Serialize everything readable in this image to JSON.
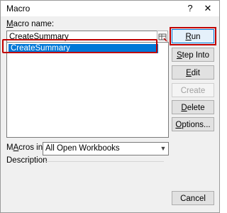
{
  "window": {
    "title": "Macro",
    "help_glyph": "?",
    "close_glyph": "✕"
  },
  "macro_name": {
    "label_mnemonic": "M",
    "label_rest": "acro name:",
    "value": "CreateSummary"
  },
  "macro_list": {
    "items": [
      "CreateSummary"
    ]
  },
  "buttons": {
    "run": {
      "mnemonic": "R",
      "rest": "un"
    },
    "step_into": {
      "mnemonic": "S",
      "rest": "tep Into"
    },
    "edit": {
      "mnemonic": "E",
      "rest": "dit"
    },
    "create": {
      "label": "Create"
    },
    "delete": {
      "mnemonic": "D",
      "rest": "elete"
    },
    "options": {
      "mnemonic": "O",
      "rest": "ptions..."
    },
    "cancel": {
      "label": "Cancel"
    }
  },
  "macros_in": {
    "label_mnemonic": "A",
    "label_prefix": "M",
    "label_rest": "cros in:",
    "value": "All Open Workbooks"
  },
  "description": {
    "label": "Description"
  },
  "colors": {
    "highlight_outline": "#c00000",
    "selection": "#0078d7"
  }
}
